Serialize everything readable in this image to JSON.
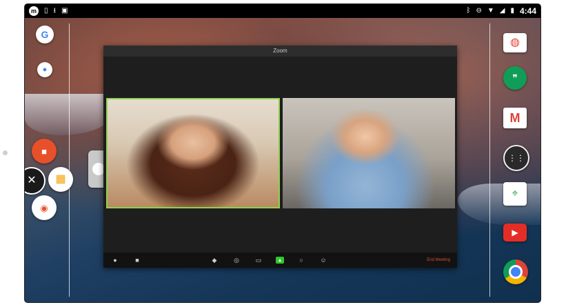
{
  "statusbar": {
    "left_icons": [
      "app-m-icon",
      "phone-icon",
      "download-icon",
      "clipboard-icon"
    ],
    "time": "4:44",
    "right_icons": [
      "bluetooth-icon",
      "do-not-disturb-icon",
      "wifi-icon",
      "signal-icon",
      "battery-icon"
    ]
  },
  "zoom": {
    "title": "Zoom",
    "toolbar": {
      "end_meeting": "End Meeting"
    }
  },
  "dock_left": [
    "google-search-icon",
    "microphone-icon",
    "video-camera-icon",
    "close-icon",
    "apps-grid-icon",
    "camera-icon"
  ],
  "dock_right": [
    "chrome-web-icon",
    "hangouts-icon",
    "gmail-icon",
    "app-drawer-icon",
    "maps-icon",
    "youtube-icon",
    "chrome-icon"
  ],
  "colors": {
    "zoom_active_border": "#8fd14f",
    "end_meeting": "#e04a3a",
    "share_green": "#31c52e"
  }
}
